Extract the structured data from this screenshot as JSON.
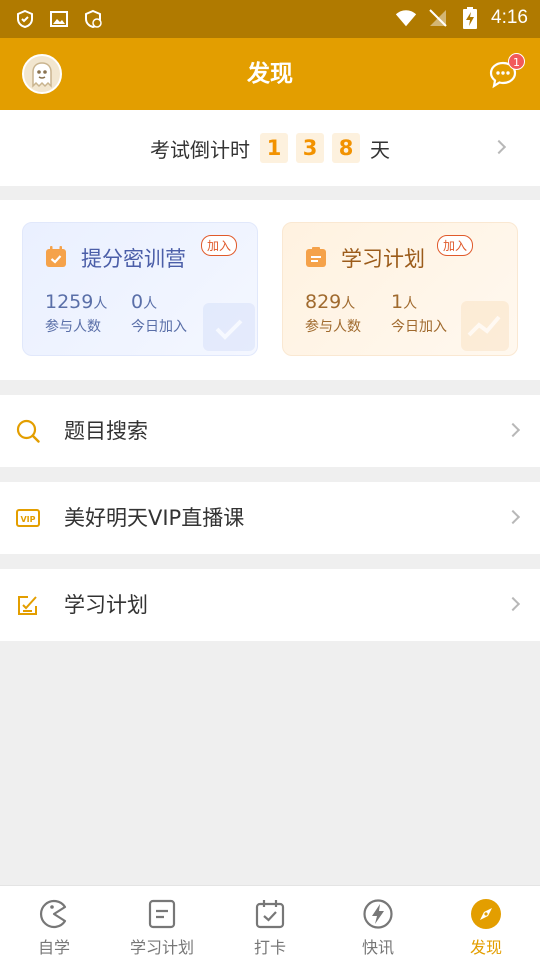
{
  "status_bar": {
    "time": "4:16"
  },
  "header": {
    "title": "发现",
    "message_badge": "1"
  },
  "countdown": {
    "label": "考试倒计时",
    "digits": [
      "1",
      "3",
      "8"
    ],
    "unit": "天"
  },
  "cards": [
    {
      "title": "提分密训营",
      "join": "加入",
      "stat1_num": "1259",
      "stat1_unit": "人",
      "stat1_label": "参与人数",
      "stat2_num": "0",
      "stat2_unit": "人",
      "stat2_label": "今日加入"
    },
    {
      "title": "学习计划",
      "join": "加入",
      "stat1_num": "829",
      "stat1_unit": "人",
      "stat1_label": "参与人数",
      "stat2_num": "1",
      "stat2_unit": "人",
      "stat2_label": "今日加入"
    }
  ],
  "list": [
    {
      "label": "题目搜索",
      "icon": "search-icon"
    },
    {
      "label": "美好明天VIP直播课",
      "icon": "vip-icon"
    },
    {
      "label": "学习计划",
      "icon": "edit-icon"
    }
  ],
  "tabs": [
    {
      "label": "自学",
      "icon": "pacman-icon"
    },
    {
      "label": "学习计划",
      "icon": "document-icon"
    },
    {
      "label": "打卡",
      "icon": "calendar-check-icon"
    },
    {
      "label": "快讯",
      "icon": "lightning-icon"
    },
    {
      "label": "发现",
      "icon": "compass-icon"
    }
  ],
  "colors": {
    "accent": "#e39e00",
    "statusbar": "#b07a00",
    "digit": "#f29200"
  }
}
